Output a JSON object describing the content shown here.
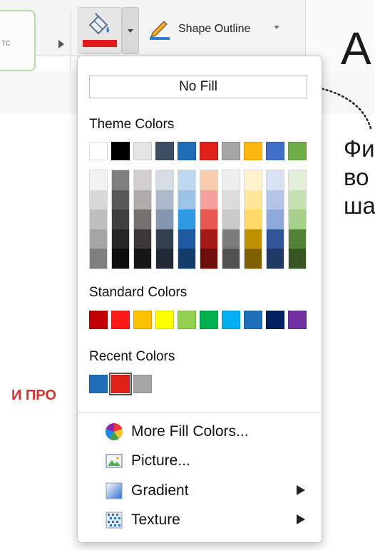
{
  "ribbon": {
    "style_label": "тс",
    "shape_outline_label": "Shape Outline",
    "big_letter": "A",
    "fill_color": "#e21a1a"
  },
  "background_text": {
    "ru_lines": [
      "Фи",
      "во",
      "ша"
    ],
    "red_text": "И ПРО"
  },
  "menu": {
    "no_fill": "No Fill",
    "theme_title": "Theme Colors",
    "theme_colors": [
      "#ffffff",
      "#000000",
      "#e5e5e5",
      "#3f4f63",
      "#1f6fb8",
      "#e0211b",
      "#a5a5a5",
      "#fcb713",
      "#3f6fc6",
      "#70ad47"
    ],
    "theme_shades": [
      [
        "#f2f2f2",
        "#d8d8d8",
        "#bfbfbf",
        "#a5a5a5",
        "#7f7f7f"
      ],
      [
        "#7f7f7f",
        "#595959",
        "#404040",
        "#262626",
        "#0d0d0d"
      ],
      [
        "#d0cece",
        "#aeabab",
        "#757171",
        "#3a3838",
        "#171616"
      ],
      [
        "#d6dce4",
        "#adb9ca",
        "#8496b0",
        "#323f4f",
        "#222a35"
      ],
      [
        "#bdd7ee",
        "#9dc3e6",
        "#2e9ae6",
        "#1e5aa0",
        "#123d6b"
      ],
      [
        "#f8cbad",
        "#f4a09b",
        "#e8584f",
        "#a51a16",
        "#6e0e0c"
      ],
      [
        "#ededed",
        "#dbdbdb",
        "#c9c9c9",
        "#7b7b7b",
        "#525252"
      ],
      [
        "#fff2cc",
        "#ffe699",
        "#ffd966",
        "#bf9000",
        "#7f6000"
      ],
      [
        "#d9e2f3",
        "#b4c6e7",
        "#8eaadb",
        "#2f5597",
        "#203864"
      ],
      [
        "#e2efd9",
        "#c5e0b3",
        "#a8d08d",
        "#538135",
        "#375623"
      ]
    ],
    "standard_title": "Standard Colors",
    "standard_colors": [
      "#c00000",
      "#ff1a1a",
      "#ffc000",
      "#ffff00",
      "#92d050",
      "#00b050",
      "#00b0f0",
      "#1f6fb8",
      "#002060",
      "#7030a0"
    ],
    "recent_title": "Recent Colors",
    "recent_colors": [
      "#1f6fb8",
      "#e0211b",
      "#a5a5a5"
    ],
    "items": [
      {
        "label": "More Fill Colors...",
        "icon": "color-wheel-icon"
      },
      {
        "label": "Picture...",
        "icon": "picture-icon"
      },
      {
        "label": "Gradient",
        "icon": "gradient-icon"
      },
      {
        "label": "Texture",
        "icon": "texture-icon"
      }
    ]
  }
}
